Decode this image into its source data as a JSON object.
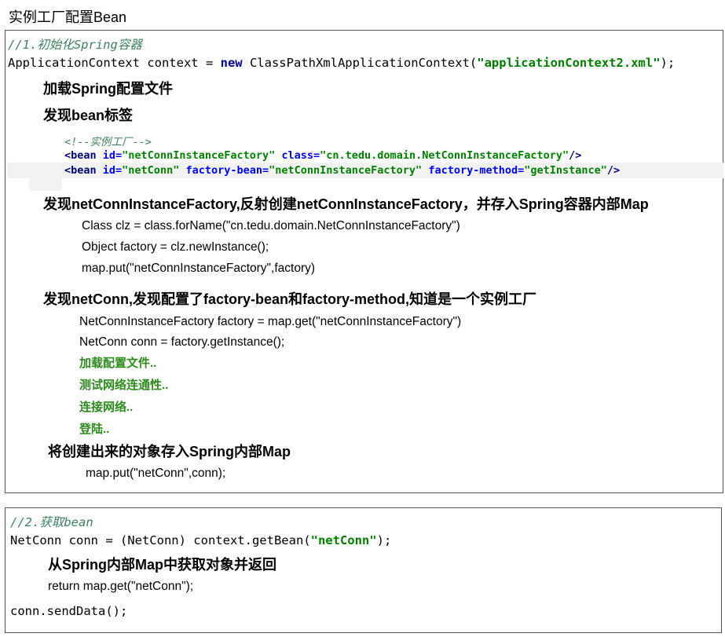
{
  "title": "实例工厂配置Bean",
  "box1": {
    "comment": "//1.初始化Spring容器",
    "ctx_type": "ApplicationContext context = ",
    "ctx_new": "new",
    "ctx_class": " ClassPathXmlApplicationContext(",
    "ctx_file": "\"applicationContext2.xml\"",
    "ctx_end": ");",
    "step_load": "加载Spring配置文件",
    "step_find_bean": "发现bean标签",
    "xml_comment": "<!--实例工厂-->",
    "xml1": {
      "open": "<bean ",
      "a1": "id=",
      "v1": "\"netConnInstanceFactory\"",
      "a2": " class=",
      "v2": "\"cn.tedu.domain.NetConnInstanceFactory\"",
      "close": "/>"
    },
    "xml2": {
      "open": "<bean ",
      "a1": "id=",
      "v1": "\"netConn\"",
      "a2": " factory-bean=",
      "v2": "\"netConnInstanceFactory\"",
      "a3": " factory-method=",
      "v3": "\"getInstance\"",
      "close": "/>"
    },
    "step_reflect": "发现netConnInstanceFactory,反射创建netConnInstanceFactory，并存入Spring容器内部Map",
    "reflect_lines": [
      "Class clz = class.forName(\"cn.tedu.domain.NetConnInstanceFactory\")",
      "Object factory = clz.newInstance();",
      "map.put(\"netConnInstanceFactory\",factory)"
    ],
    "step_netconn": "发现netConn,发现配置了factory-bean和factory-method,知道是一个实例工厂",
    "netconn_lines": [
      "NetConnInstanceFactory factory = map.get(\"netConnInstanceFactory\")",
      "NetConn conn = factory.getInstance();"
    ],
    "output_lines": [
      "加载配置文件..",
      "测试网络连通性..",
      "连接网络..",
      "登陆.."
    ],
    "step_store": "将创建出来的对象存入Spring内部Map",
    "store_line": "map.put(\"netConn\",conn);"
  },
  "box2": {
    "comment": "//2.获取bean",
    "get_pre": "NetConn conn = (NetConn) context.getBean(",
    "get_str": "\"netConn\"",
    "get_end": ");",
    "step_get": "从Spring内部Map中获取对象并返回",
    "return_line": "return map.get(\"netConn\");",
    "send_line": "conn.sendData();"
  }
}
